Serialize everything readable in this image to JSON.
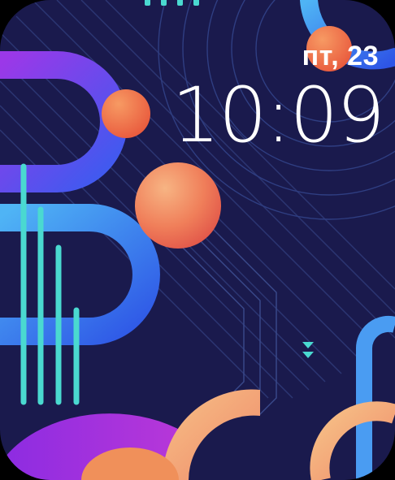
{
  "watch_face": {
    "date": "пт, 23",
    "time": "10:09",
    "colors": {
      "background": "#1a1a4d",
      "purple": "#9b38e8",
      "blue": "#3a8df0",
      "teal": "#4ad9d0",
      "orange": "#f06a3a",
      "peach": "#f5b07a"
    },
    "icons": [
      "chevron-down-icon",
      "page-indicator-icon"
    ]
  }
}
